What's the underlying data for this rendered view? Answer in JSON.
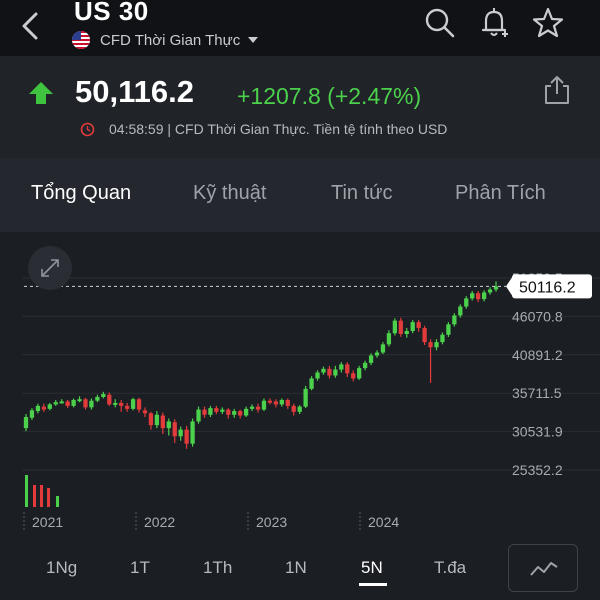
{
  "header": {
    "title": "US 30",
    "subtitle": "CFD Thời Gian Thực"
  },
  "quote": {
    "price": "50,116.2",
    "change": "+1207.8 (+2.47%)",
    "time_info": "04:58:59 | CFD Thời Gian Thực. Tiền tệ tính theo USD"
  },
  "tabs": [
    {
      "label": "Tổng Quan",
      "active": true
    },
    {
      "label": "Kỹ thuật",
      "active": false
    },
    {
      "label": "Tin tức",
      "active": false
    },
    {
      "label": "Phân Tích",
      "active": false
    }
  ],
  "ranges": [
    {
      "label": "1Ng"
    },
    {
      "label": "1T"
    },
    {
      "label": "1Th"
    },
    {
      "label": "1N"
    },
    {
      "label": "5N",
      "active": true
    },
    {
      "label": "T.đa"
    }
  ],
  "colors": {
    "up": "#4cd14c",
    "down": "#e23b3b",
    "background": "#1b1e23"
  },
  "chart_data": {
    "type": "candlestick",
    "y_ticks": [
      "51250.5",
      "46070.8",
      "40891.2",
      "35711.5",
      "30531.9",
      "25352.2"
    ],
    "y_tick_values": [
      51250.5,
      46070.8,
      40891.2,
      35711.5,
      30531.9,
      25352.2
    ],
    "x_ticks": [
      "2021",
      "2022",
      "2023",
      "2024"
    ],
    "last_price_label": "50116.2",
    "last_price": 50116.2,
    "candles": [
      [
        31000,
        32500,
        30600,
        32900
      ],
      [
        32400,
        33400,
        32100,
        33700
      ],
      [
        33300,
        34000,
        33000,
        34300
      ],
      [
        33900,
        33500,
        33200,
        34300
      ],
      [
        33600,
        34200,
        33400,
        34400
      ],
      [
        34200,
        34500,
        34000,
        34800
      ],
      [
        34500,
        34600,
        34300,
        34900
      ],
      [
        34600,
        34000,
        33700,
        34800
      ],
      [
        34000,
        34800,
        33800,
        35000
      ],
      [
        34800,
        34900,
        34500,
        35300
      ],
      [
        34900,
        33800,
        33500,
        35100
      ],
      [
        33800,
        34700,
        33500,
        35000
      ],
      [
        34700,
        35200,
        34500,
        35500
      ],
      [
        35200,
        35600,
        35000,
        35900
      ],
      [
        35500,
        34200,
        34000,
        35800
      ],
      [
        34300,
        34400,
        33800,
        34900
      ],
      [
        34400,
        34000,
        33200,
        34800
      ],
      [
        34000,
        33600,
        33200,
        34400
      ],
      [
        33600,
        34900,
        33400,
        35100
      ],
      [
        34900,
        33500,
        33100,
        35100
      ],
      [
        33400,
        33000,
        32500,
        33800
      ],
      [
        33000,
        31400,
        30800,
        33200
      ],
      [
        31400,
        32800,
        31000,
        33300
      ],
      [
        32700,
        31000,
        30200,
        33100
      ],
      [
        31000,
        31900,
        30000,
        32300
      ],
      [
        31800,
        29900,
        29000,
        32200
      ],
      [
        29900,
        30800,
        29300,
        31200
      ],
      [
        30800,
        28900,
        28200,
        31300
      ],
      [
        28900,
        31900,
        28500,
        32300
      ],
      [
        31900,
        33500,
        31600,
        33900
      ],
      [
        33500,
        32800,
        32400,
        33900
      ],
      [
        32800,
        33700,
        32500,
        34000
      ],
      [
        33700,
        33200,
        32900,
        34000
      ],
      [
        33200,
        33500,
        32900,
        33800
      ],
      [
        33500,
        32800,
        32300,
        33700
      ],
      [
        32800,
        33300,
        32400,
        33600
      ],
      [
        33300,
        32700,
        32300,
        33500
      ],
      [
        32700,
        33600,
        32500,
        33900
      ],
      [
        33600,
        33900,
        33300,
        34200
      ],
      [
        33900,
        33500,
        33100,
        34300
      ],
      [
        33500,
        34700,
        33300,
        35000
      ],
      [
        34700,
        34600,
        34200,
        35000
      ],
      [
        34600,
        34200,
        33800,
        34900
      ],
      [
        34200,
        34800,
        33900,
        35000
      ],
      [
        34800,
        34000,
        33600,
        35000
      ],
      [
        34000,
        33200,
        32700,
        34300
      ],
      [
        33200,
        33900,
        32900,
        34100
      ],
      [
        33900,
        36300,
        33700,
        36700
      ],
      [
        36300,
        37700,
        36100,
        38000
      ],
      [
        37700,
        38500,
        37400,
        38800
      ],
      [
        38500,
        39000,
        38200,
        39300
      ],
      [
        39000,
        38100,
        37700,
        39400
      ],
      [
        38100,
        38900,
        37800,
        39400
      ],
      [
        38900,
        39600,
        38500,
        39900
      ],
      [
        39600,
        38400,
        37900,
        39900
      ],
      [
        38400,
        37700,
        37300,
        38800
      ],
      [
        37700,
        39100,
        37500,
        39400
      ],
      [
        39100,
        39800,
        38800,
        40100
      ],
      [
        39800,
        40800,
        39500,
        41100
      ],
      [
        40800,
        41200,
        40500,
        41500
      ],
      [
        41200,
        42300,
        41000,
        42600
      ],
      [
        42300,
        43800,
        42000,
        44200
      ],
      [
        43800,
        45500,
        43500,
        45800
      ],
      [
        45500,
        43700,
        43300,
        45900
      ],
      [
        43700,
        44100,
        43200,
        44500
      ],
      [
        44100,
        45300,
        43800,
        45600
      ],
      [
        45300,
        44500,
        44000,
        45600
      ],
      [
        44500,
        42600,
        42200,
        44800
      ],
      [
        42600,
        41900,
        37100,
        43000
      ],
      [
        41900,
        42600,
        41500,
        43000
      ],
      [
        42600,
        43600,
        42300,
        43900
      ],
      [
        43600,
        45000,
        43300,
        45300
      ],
      [
        45000,
        46200,
        44700,
        46500
      ],
      [
        46200,
        47400,
        45900,
        47700
      ],
      [
        47400,
        48500,
        47100,
        48800
      ],
      [
        48500,
        49200,
        48200,
        49500
      ],
      [
        49200,
        48400,
        48000,
        49500
      ],
      [
        48400,
        49300,
        48100,
        49600
      ],
      [
        49300,
        49700,
        49000,
        50000
      ],
      [
        49700,
        50116,
        49400,
        50800
      ]
    ],
    "volume_bars": [
      {
        "value": 0.32,
        "color": "up"
      },
      {
        "value": 0.22,
        "color": "down"
      },
      {
        "value": 0.22,
        "color": "down"
      },
      {
        "value": 0.19,
        "color": "down"
      },
      {
        "value": 0.11,
        "color": "up"
      }
    ]
  }
}
